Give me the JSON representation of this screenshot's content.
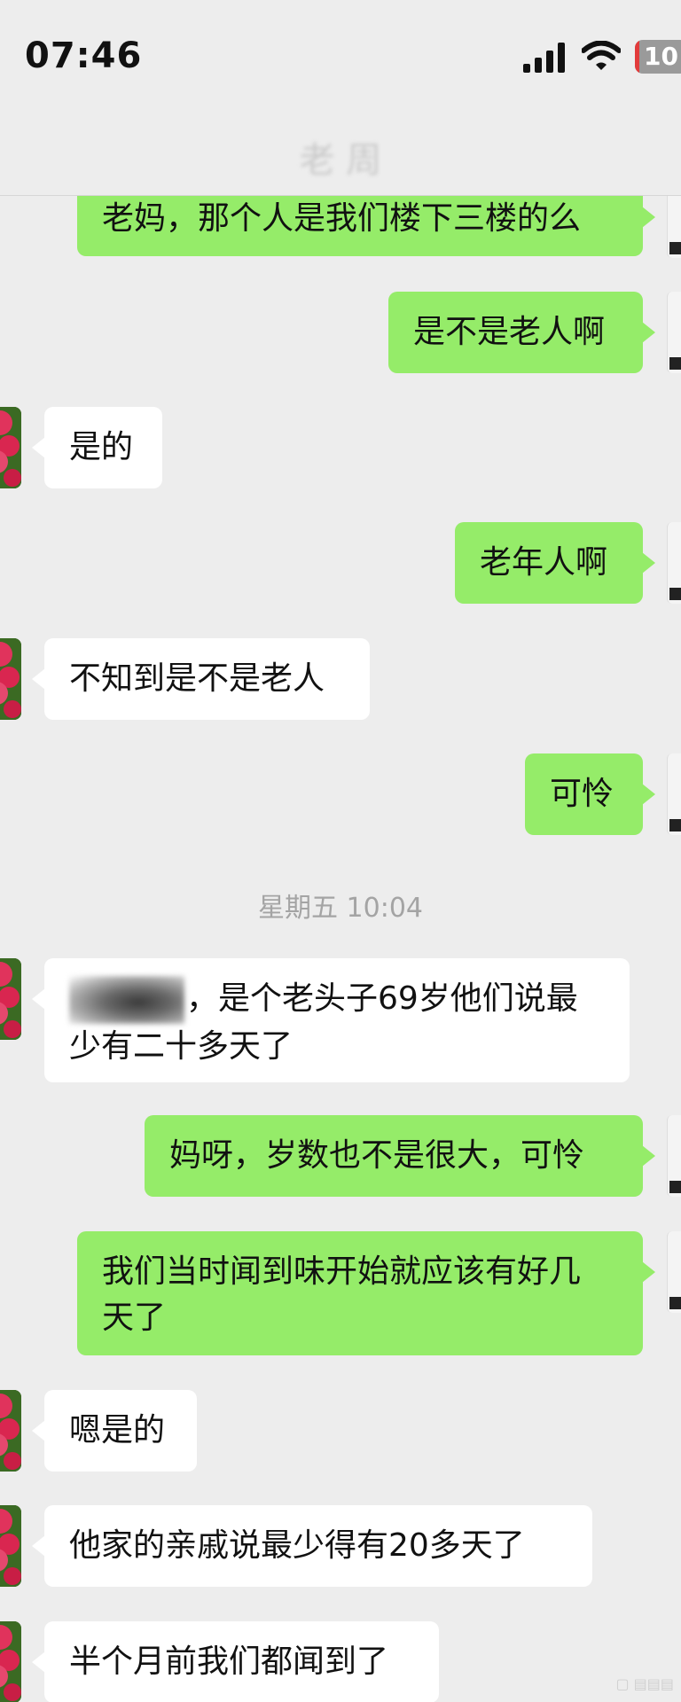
{
  "status_bar": {
    "time": "07:46",
    "battery": "10",
    "icons": [
      "signal-icon",
      "wifi-icon",
      "battery-icon"
    ]
  },
  "header": {
    "title": "老 周"
  },
  "messages": [
    {
      "side": "sent",
      "text": "老妈，那个人是我们楼下三楼的么"
    },
    {
      "side": "sent",
      "text": "是不是老人啊"
    },
    {
      "side": "recv",
      "text": "是的"
    },
    {
      "side": "sent",
      "text": "老年人啊"
    },
    {
      "side": "recv",
      "text": "不知到是不是老人"
    },
    {
      "side": "sent",
      "text": "可怜"
    },
    {
      "side": "recv",
      "line1": "，是个老头子69岁他们说最",
      "line2": "少有二十多天了"
    },
    {
      "side": "sent",
      "text": "妈呀，岁数也不是很大，可怜"
    },
    {
      "side": "sent",
      "line1": "我们当时闻到味开始就应该有好几",
      "line2": "天了"
    },
    {
      "side": "recv",
      "text": "嗯是的"
    },
    {
      "side": "recv",
      "text": "他家的亲戚说最少得有20多天了"
    },
    {
      "side": "recv",
      "text": "半个月前我们都闻到了"
    }
  ],
  "divider": {
    "text": "星期五 10:04"
  },
  "colors": {
    "background": "#ededed",
    "sent_bubble": "#95ec69",
    "recv_bubble": "#ffffff"
  }
}
